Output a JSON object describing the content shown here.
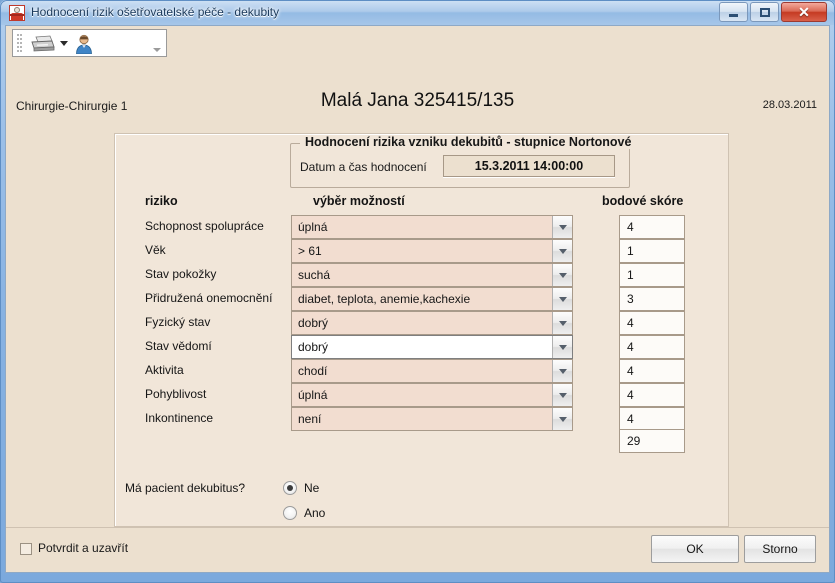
{
  "window": {
    "title": "Hodnocení rizik ošetřovatelské péče - dekubity",
    "icon": "nurse-app-icon",
    "controls": {
      "minimize": "minimize-icon",
      "maximize": "maximize-icon",
      "close": "✕"
    }
  },
  "toolbar": {
    "grip": "drag-grip",
    "print_icon": "printer-icon",
    "print_dropdown_icon": "chevron-down-icon",
    "patient_icon": "person-icon",
    "overflow_icon": "toolbar-overflow-icon"
  },
  "header": {
    "department": "Chirurgie-Chirurgie 1",
    "patient": "Malá Jana 325415/135",
    "date": "28.03.2011"
  },
  "groupbox": {
    "title": "Hodnocení rizika vzniku dekubitů - stupnice Nortonové",
    "datetime_label": "Datum a čas hodnocení",
    "datetime_value": "15.3.2011 14:00:00"
  },
  "table": {
    "headers": {
      "risk": "riziko",
      "choice": "výběr možností",
      "score": "bodové skóre"
    },
    "rows": [
      {
        "label": "Schopnost spolupráce",
        "value": "úplná",
        "score": "4",
        "focused": false
      },
      {
        "label": "Věk",
        "value": "> 61",
        "score": "1",
        "focused": false
      },
      {
        "label": "Stav pokožky",
        "value": "suchá",
        "score": "1",
        "focused": false
      },
      {
        "label": "Přidružená onemocnění",
        "value": "diabet, teplota, anemie,kachexie",
        "score": "3",
        "focused": false
      },
      {
        "label": "Fyzický stav",
        "value": "dobrý",
        "score": "4",
        "focused": false
      },
      {
        "label": "Stav vědomí",
        "value": "dobrý",
        "score": "4",
        "focused": true
      },
      {
        "label": "Aktivita",
        "value": "chodí",
        "score": "4",
        "focused": false
      },
      {
        "label": "Pohyblivost",
        "value": "úplná",
        "score": "4",
        "focused": false
      },
      {
        "label": "Inkontinence",
        "value": "není",
        "score": "4",
        "focused": false
      }
    ],
    "total": "29"
  },
  "decubitus": {
    "question": "Má pacient dekubitus?",
    "options": [
      {
        "label": "Ne",
        "selected": true
      },
      {
        "label": "Ano",
        "selected": false
      }
    ]
  },
  "footer": {
    "confirm_label": "Potvrdit a uzavřít",
    "confirm_checked": false,
    "ok_label": "OK",
    "cancel_label": "Storno"
  },
  "colors": {
    "client_bg": "#ece0cf",
    "panel_bg": "#f1e6d9",
    "combo_bg": "#f2ddd0",
    "combo_focused_bg": "#ffffff",
    "frame_blue": "#7ba9dd",
    "close_red": "#c53a22"
  }
}
